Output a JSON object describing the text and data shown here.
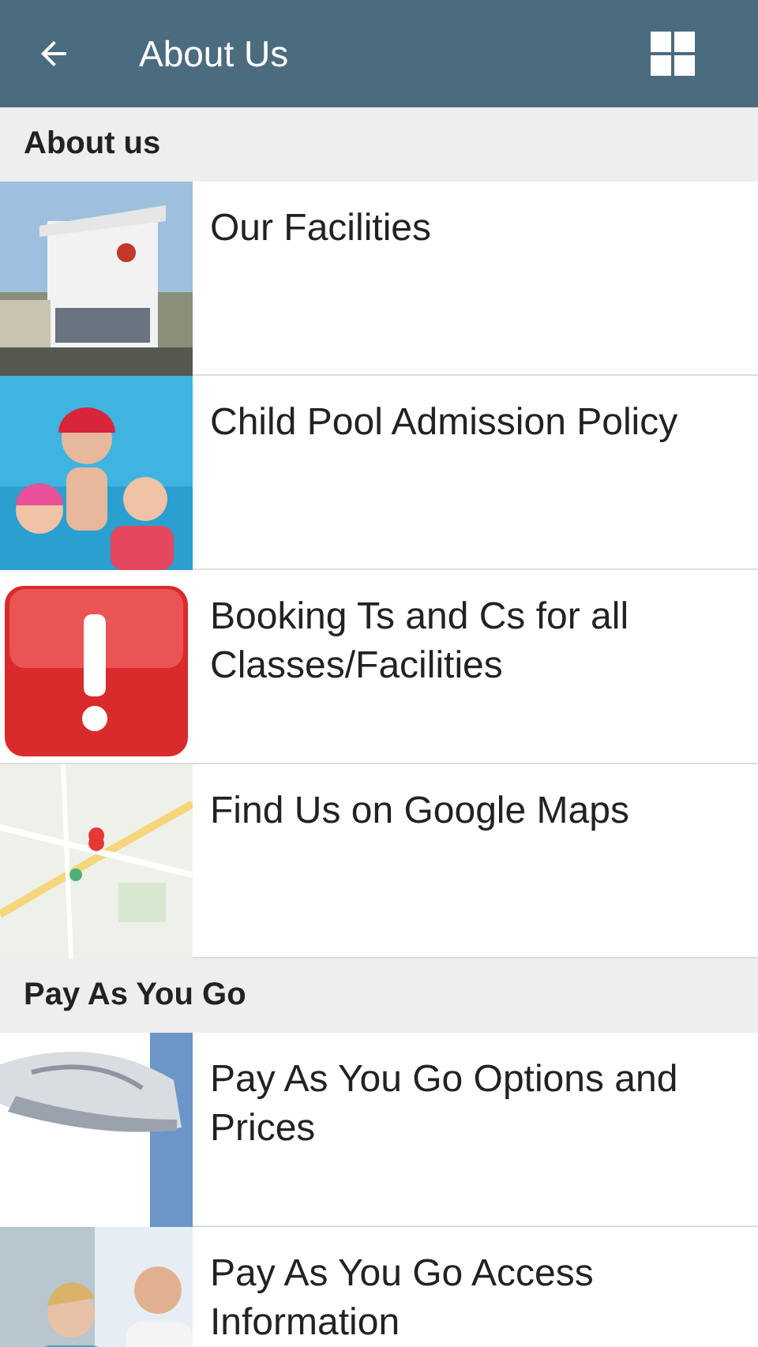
{
  "app_bar": {
    "title": "About Us"
  },
  "sections": [
    {
      "heading": "About us",
      "items": [
        {
          "title": "Our Facilities",
          "kind": "picture"
        },
        {
          "title": "Child Pool Admission Policy",
          "kind": "picture"
        },
        {
          "title": "Booking Ts and Cs for all Classes/Facilities",
          "kind": "alert"
        },
        {
          "title": "Find Us on Google Maps",
          "kind": "picture"
        }
      ]
    },
    {
      "heading": "Pay As You Go",
      "items": [
        {
          "title": "Pay As You Go Options and Prices",
          "kind": "picture"
        },
        {
          "title": "Pay As You Go Access Information",
          "kind": "picture"
        }
      ]
    }
  ]
}
